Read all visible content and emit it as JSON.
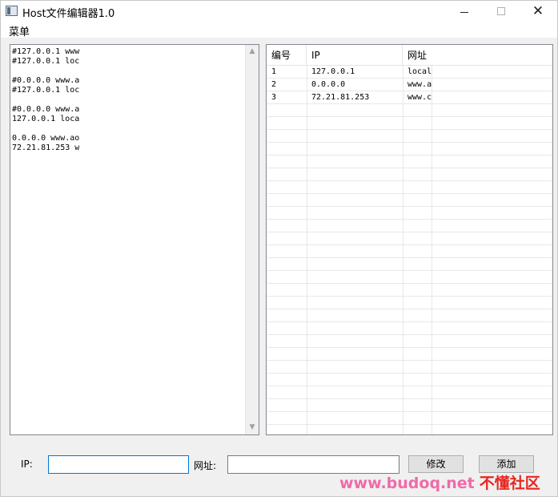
{
  "window": {
    "title": "Host文件编辑器1.0",
    "controls": {
      "minimize": "—",
      "maximize": "☐",
      "close": "✕"
    }
  },
  "menu": {
    "label": "菜单"
  },
  "editor": {
    "lines": "#127.0.0.1 www\n#127.0.0.1 loc\n\n#0.0.0.0 www.a\n#127.0.0.1 loc\n\n#0.0.0.0 www.a\n127.0.0.1 loca\n\n0.0.0.0 www.ao\n72.21.81.253 w"
  },
  "table": {
    "headers": [
      "编号",
      "IP",
      "网址"
    ],
    "rows": [
      [
        "1",
        "127.0.0.1",
        "local"
      ],
      [
        "2",
        "0.0.0.0",
        "www.a"
      ],
      [
        "3",
        "72.21.81.253",
        "www.c"
      ]
    ]
  },
  "form": {
    "ip_label": "IP:",
    "ip_value": "",
    "url_label": "网址:",
    "url_value": "",
    "edit_button": "修改",
    "add_button": "添加"
  },
  "watermark": {
    "url": "www.budoq.net",
    "name": "不懂社区"
  },
  "colors": {
    "focus_border": "#0078d7",
    "watermark_url": "#f06aa8",
    "watermark_name": "#e8261f"
  }
}
